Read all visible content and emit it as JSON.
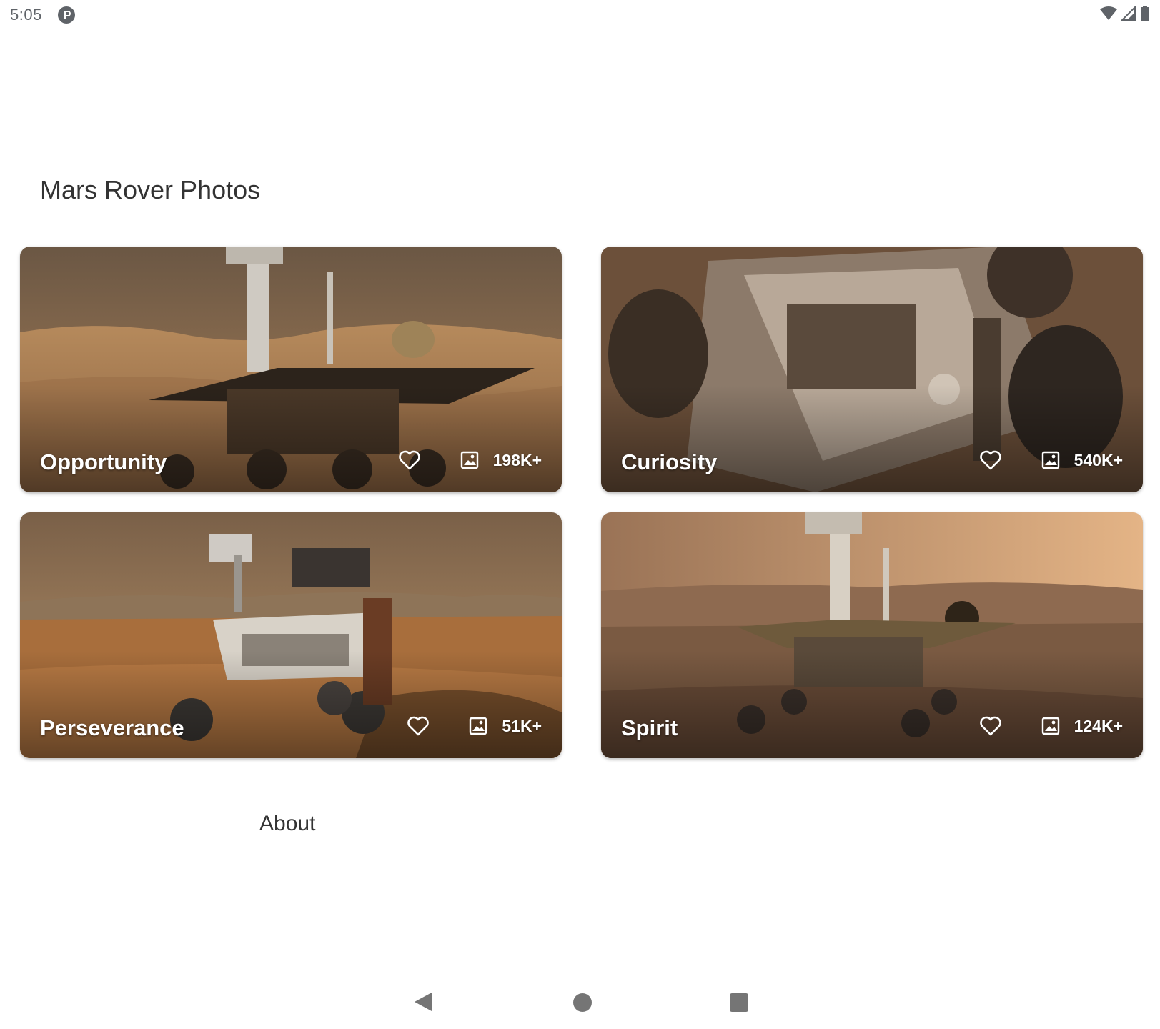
{
  "status_bar": {
    "time": "5:05",
    "app_icon": "parking-app-icon",
    "right_icons": [
      "wifi-icon",
      "cell-signal-icon",
      "battery-icon"
    ]
  },
  "header": {
    "title": "Mars Rover Photos"
  },
  "rovers": [
    {
      "name": "Opportunity",
      "photo_count": "198K+",
      "favorite_icon": "heart-outline-icon",
      "photos_icon": "image-icon"
    },
    {
      "name": "Curiosity",
      "photo_count": "540K+",
      "favorite_icon": "heart-outline-icon",
      "photos_icon": "image-icon"
    },
    {
      "name": "Perseverance",
      "photo_count": "51K+",
      "favorite_icon": "heart-outline-icon",
      "photos_icon": "image-icon"
    },
    {
      "name": "Spirit",
      "photo_count": "124K+",
      "favorite_icon": "heart-outline-icon",
      "photos_icon": "image-icon"
    }
  ],
  "footer": {
    "about_label": "About"
  },
  "nav_bar": {
    "icons": [
      "back-icon",
      "home-icon",
      "recents-icon"
    ]
  },
  "colors": {
    "title_text": "#333333",
    "status_icons": "#5f6368",
    "nav_icons": "#757575",
    "card_text": "#ffffff",
    "mars_sand": "#b57a45",
    "mars_sky": "#c9955f"
  }
}
